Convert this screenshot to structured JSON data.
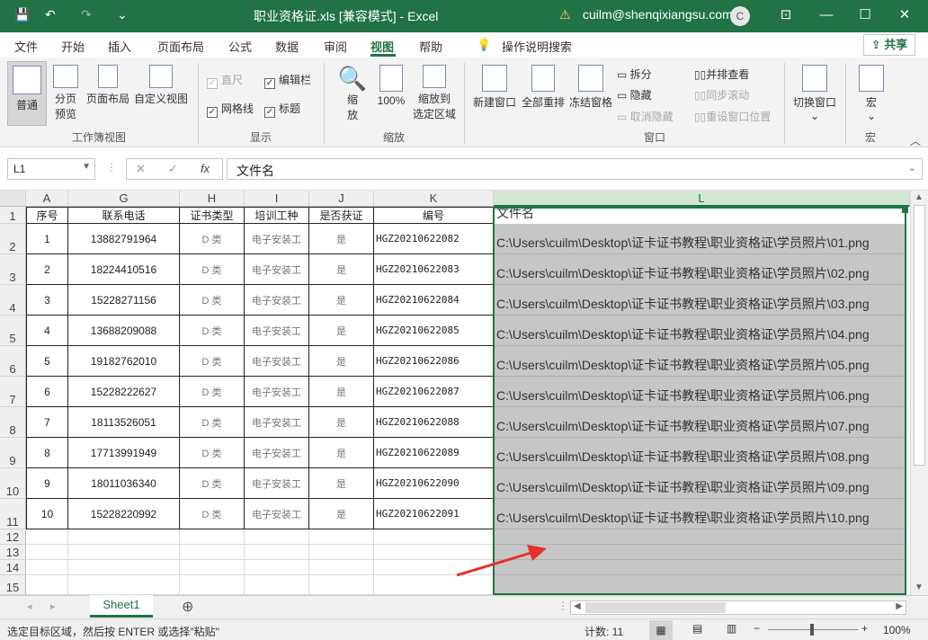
{
  "titlebar": {
    "title": "职业资格证.xls [兼容模式] - Excel",
    "user": "cuilm@shenqixiangsu.com",
    "avatar": "C",
    "save": "💾",
    "undo": "↶",
    "redo": "↷",
    "qat_more": "⌄",
    "warn": "⚠",
    "ribbon_opts": "⊡",
    "min": "—",
    "max": "☐",
    "close": "✕"
  },
  "menu": [
    "文件",
    "开始",
    "插入",
    "页面布局",
    "公式",
    "数据",
    "审阅",
    "视图",
    "帮助"
  ],
  "menu_active": "视图",
  "search": {
    "icon": "lightbulb-icon",
    "label": "操作说明搜索"
  },
  "share": "共享",
  "ribbon": {
    "workbook_views": {
      "normal": "普通",
      "page_break": "分页\n预览",
      "page_layout": "页面布局",
      "custom": "自定义视图",
      "group": "工作簿视图"
    },
    "show": {
      "ruler": "直尺",
      "formula_bar": "编辑栏",
      "gridlines": "网格线",
      "headings": "标题",
      "group": "显示"
    },
    "zoom": {
      "zoom": "缩\n放",
      "hundred": "100%",
      "to_selection": "缩放到\n选定区域",
      "group": "缩放"
    },
    "window": {
      "new_window": "新建窗口",
      "arrange_all": "全部重排",
      "freeze": "冻结窗格",
      "split": "拆分",
      "hide": "隐藏",
      "unhide": "取消隐藏",
      "side_by_side": "并排查看",
      "sync_scroll": "同步滚动",
      "reset_pos": "重设窗口位置",
      "switch": "切换窗口",
      "group": "窗口"
    },
    "macros": {
      "macros": "宏",
      "group": "宏"
    }
  },
  "formula_bar": {
    "name_box": "L1",
    "formula": "文件名",
    "fx": "fx",
    "cancel": "✕",
    "enter": "✓"
  },
  "columns": [
    {
      "letter": "A",
      "header": "序号"
    },
    {
      "letter": "G",
      "header": "联系电话"
    },
    {
      "letter": "H",
      "header": "证书类型"
    },
    {
      "letter": "I",
      "header": "培训工种"
    },
    {
      "letter": "J",
      "header": "是否获证"
    },
    {
      "letter": "K",
      "header": "编号"
    },
    {
      "letter": "L",
      "header": "文件名"
    }
  ],
  "rows": [
    {
      "n": "2",
      "seq": "1",
      "phone": "13882791964",
      "type": "D 类",
      "trade": "电子安装工",
      "cert": "是",
      "code": "HGZ20210622082",
      "file": "C:\\Users\\cuilm\\Desktop\\证卡证书教程\\职业资格证\\学员照片\\01.png"
    },
    {
      "n": "3",
      "seq": "2",
      "phone": "18224410516",
      "type": "D 类",
      "trade": "电子安装工",
      "cert": "是",
      "code": "HGZ20210622083",
      "file": "C:\\Users\\cuilm\\Desktop\\证卡证书教程\\职业资格证\\学员照片\\02.png"
    },
    {
      "n": "4",
      "seq": "3",
      "phone": "15228271156",
      "type": "D 类",
      "trade": "电子安装工",
      "cert": "是",
      "code": "HGZ20210622084",
      "file": "C:\\Users\\cuilm\\Desktop\\证卡证书教程\\职业资格证\\学员照片\\03.png"
    },
    {
      "n": "5",
      "seq": "4",
      "phone": "13688209088",
      "type": "D 类",
      "trade": "电子安装工",
      "cert": "是",
      "code": "HGZ20210622085",
      "file": "C:\\Users\\cuilm\\Desktop\\证卡证书教程\\职业资格证\\学员照片\\04.png"
    },
    {
      "n": "6",
      "seq": "5",
      "phone": "19182762010",
      "type": "D 类",
      "trade": "电子安装工",
      "cert": "是",
      "code": "HGZ20210622086",
      "file": "C:\\Users\\cuilm\\Desktop\\证卡证书教程\\职业资格证\\学员照片\\05.png"
    },
    {
      "n": "7",
      "seq": "6",
      "phone": "15228222627",
      "type": "D 类",
      "trade": "电子安装工",
      "cert": "是",
      "code": "HGZ20210622087",
      "file": "C:\\Users\\cuilm\\Desktop\\证卡证书教程\\职业资格证\\学员照片\\06.png"
    },
    {
      "n": "8",
      "seq": "7",
      "phone": "18113526051",
      "type": "D 类",
      "trade": "电子安装工",
      "cert": "是",
      "code": "HGZ20210622088",
      "file": "C:\\Users\\cuilm\\Desktop\\证卡证书教程\\职业资格证\\学员照片\\07.png"
    },
    {
      "n": "9",
      "seq": "8",
      "phone": "17713991949",
      "type": "D 类",
      "trade": "电子安装工",
      "cert": "是",
      "code": "HGZ20210622089",
      "file": "C:\\Users\\cuilm\\Desktop\\证卡证书教程\\职业资格证\\学员照片\\08.png"
    },
    {
      "n": "10",
      "seq": "9",
      "phone": "18011036340",
      "type": "D 类",
      "trade": "电子安装工",
      "cert": "是",
      "code": "HGZ20210622090",
      "file": "C:\\Users\\cuilm\\Desktop\\证卡证书教程\\职业资格证\\学员照片\\09.png"
    },
    {
      "n": "11",
      "seq": "10",
      "phone": "15228220992",
      "type": "D 类",
      "trade": "电子安装工",
      "cert": "是",
      "code": "HGZ20210622091",
      "file": "C:\\Users\\cuilm\\Desktop\\证卡证书教程\\职业资格证\\学员照片\\10.png"
    }
  ],
  "extra_rows": [
    "12",
    "13",
    "14",
    "15"
  ],
  "header_row": "1",
  "sheet_tab": "Sheet1",
  "add_sheet": "⊕",
  "status": {
    "message": "选定目标区域，然后按 ENTER 或选择\"粘贴\"",
    "count": "计数: 11",
    "zoom": "100%",
    "zoom_minus": "−",
    "zoom_plus": "+"
  },
  "accent": "#217346"
}
